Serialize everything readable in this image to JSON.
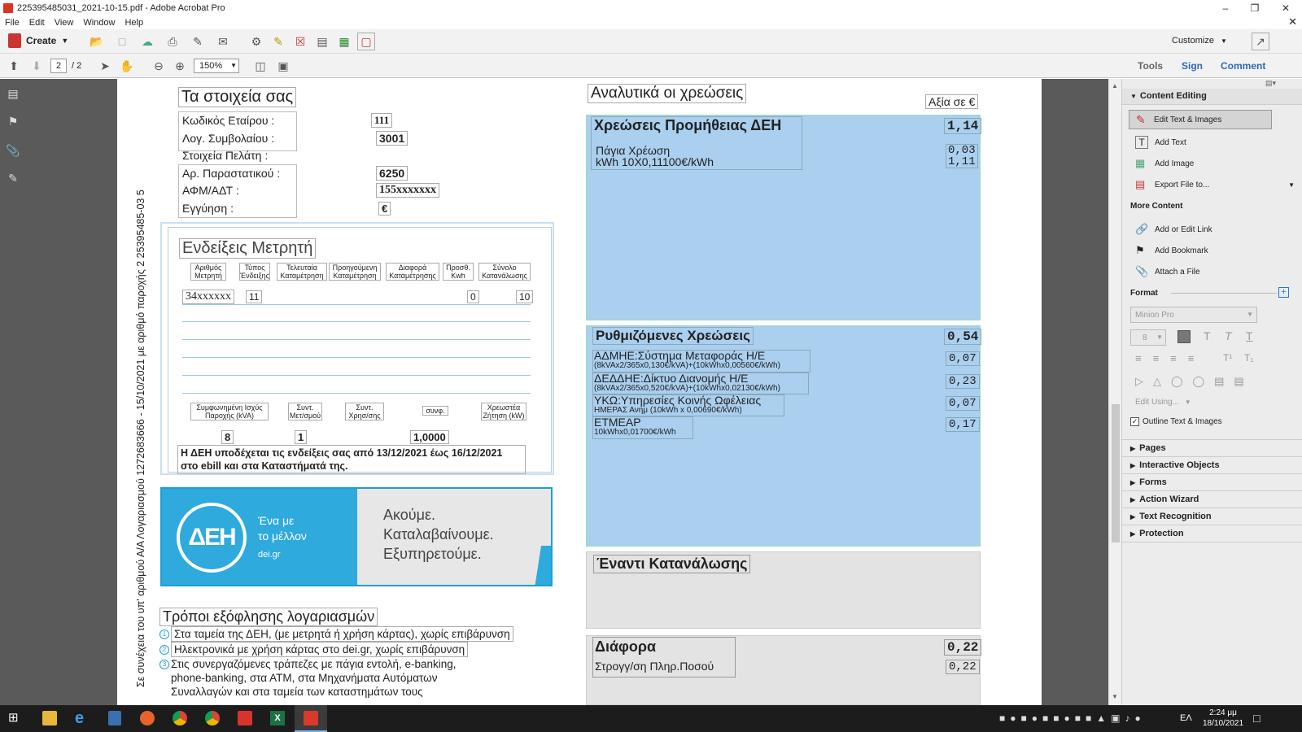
{
  "window": {
    "title": "225395485031_2021-10-15.pdf - Adobe Acrobat Pro"
  },
  "menu": [
    "File",
    "Edit",
    "View",
    "Window",
    "Help"
  ],
  "toolbar": {
    "create_label": "Create",
    "customize_label": "Customize",
    "page_current": "2",
    "page_total": "/ 2",
    "zoom": "150%",
    "tools_label": "Tools",
    "sign_label": "Sign",
    "comment_label": "Comment"
  },
  "left": {
    "header": "Τα στοιχεία σας",
    "rows": [
      {
        "label": "Κωδικός Εταίρου :",
        "value": "111"
      },
      {
        "label": "Λογ. Συμβολαίου :",
        "value": "3001"
      },
      {
        "label": "Στοιχεία Πελάτη :",
        "value": ""
      },
      {
        "label": "Αρ. Παραστατικού :",
        "value": "6250"
      },
      {
        "label": "ΑΦΜ/ΑΔΤ :",
        "value": "155xxxxxxx"
      },
      {
        "label": "Εγγύηση :",
        "value": "€"
      }
    ],
    "vertical_text": "Σε συνέχεια του υπ' αριθμού Α/Α Λογαριασμού 1272683666 - 15/10/2021 με αριθμό παροχής 2 25395485-03 5",
    "meter": {
      "title": "Ενδείξεις Μετρητή",
      "headers": [
        "Αριθμός Μετρητή",
        "Τύπος Ένδειξης",
        "Τελευταία Καταμέτρηση",
        "Προηγούμενη Καταμέτρηση",
        "Διαφορά Καταμέτρησης",
        "Προσθ. Kwh",
        "Σύνολο Κατανάλωσης"
      ],
      "row": {
        "meter_no": "34xxxxxx",
        "type": "11",
        "addkwh": "0",
        "total": "10"
      },
      "headers2": [
        "Συμφωνημένη Ισχύς Παροχής (kVA)",
        "Συντ. Μετ/σμού",
        "Συντ. Χρησ/σης",
        "συνφ.",
        "Χρεωστέα Ζήτηση (kW)"
      ],
      "row2": {
        "power": "8",
        "coef": "1",
        "cosphi": "1,0000"
      },
      "notice_line1": "Η ΔΕΗ υποδέχεται τις ενδείξεις σας από 13/12/2021 έως 16/12/2021",
      "notice_line2": "στο ebill και στα Καταστήματά της."
    },
    "banner": {
      "logo": "ΔΕΗ",
      "slogan1": "Ένα με",
      "slogan2": "το μέλλον",
      "site": "dei.gr",
      "line1": "Ακούμε.",
      "line2": "Καταλαβαίνουμε.",
      "line3": "Εξυπηρετούμε."
    },
    "payment": {
      "title": "Τρόποι εξόφλησης λογαριασμών",
      "items": [
        {
          "num": "1",
          "text": "Στα ταμεία της ΔΕΗ, (με μετρητά ή χρήση κάρτας), χωρίς επιβάρυνση"
        },
        {
          "num": "2",
          "text": "Ηλεκτρονικά με χρήση κάρτας στο dei.gr, χωρίς επιβάρυνση"
        },
        {
          "num": "3",
          "text": "Στις συνεργαζόμενες τράπεζες με πάγια εντολή, e-banking,"
        }
      ],
      "cont1": "phone-banking, στα ΑΤΜ, στα Μηχανήματα Αυτόματων",
      "cont2": "Συναλλαγών και στα ταμεία των καταστημάτων τους"
    }
  },
  "right": {
    "header": "Αναλυτικά οι χρεώσεις",
    "value_label": "Αξία σε €",
    "supply": {
      "title": "Χρεώσεις Προμήθειας ΔΕΗ",
      "amount": "1,14",
      "line1": "Πάγια Χρέωση",
      "line1_amount": "0,03",
      "line2": "kWh 10X0,11100€/kWh",
      "line2_amount": "1,11"
    },
    "regulated": {
      "title": "Ρυθμιζόμενες Χρεώσεις",
      "amount": "0,54",
      "items": [
        {
          "name": "ΑΔΜΗΕ:Σύστημα Μεταφοράς Η/Ε",
          "detail": "(8kVAx2/365x0,130€/kVA)+(10kWhx0,00560€/kWh)",
          "amount": "0,07"
        },
        {
          "name": "ΔΕΔΔΗΕ:Δίκτυο Διανομής Η/Ε",
          "detail": "(8kVAx2/365x0,520€/kVA)+(10kWhx0,02130€/kWh)",
          "amount": "0,23"
        },
        {
          "name": "ΥΚΩ:Υπηρεσίες Κοινής Ωφέλειας",
          "detail": "ΗΜΕΡΑΣ   Ανημ (10kWh x 0,00690€/kWh)",
          "amount": "0,07"
        },
        {
          "name": "ΕΤΜΕΑΡ",
          "detail": "10kWhx0,01700€/kWh",
          "amount": "0,17"
        }
      ]
    },
    "consumption": {
      "title": "Έναντι Κατανάλωσης"
    },
    "diff": {
      "title": "Διάφορα",
      "amount": "0,22",
      "line": "Στρογγ/ση Πληρ.Ποσού",
      "line_amount": "0,22"
    }
  },
  "panel": {
    "content_editing": "Content Editing",
    "tools": [
      "Edit Text & Images",
      "Add Text",
      "Add Image",
      "Export File to..."
    ],
    "more_content": "More Content",
    "more_tools": [
      "Add or Edit Link",
      "Add Bookmark",
      "Attach a File"
    ],
    "format": "Format",
    "font": "Minion Pro",
    "font_size": "8",
    "edit_using": "Edit Using...",
    "outline": "Outline Text & Images",
    "sections": [
      "Pages",
      "Interactive Objects",
      "Forms",
      "Action Wizard",
      "Text Recognition",
      "Protection"
    ]
  },
  "taskbar": {
    "lang": "ΕΛ",
    "time": "2:24 μμ",
    "date": "18/10/2021"
  },
  "colors": {
    "charge_blue": "#aacfef",
    "grey_block": "#e3e3e3",
    "dei_blue": "#1c9fd8"
  }
}
